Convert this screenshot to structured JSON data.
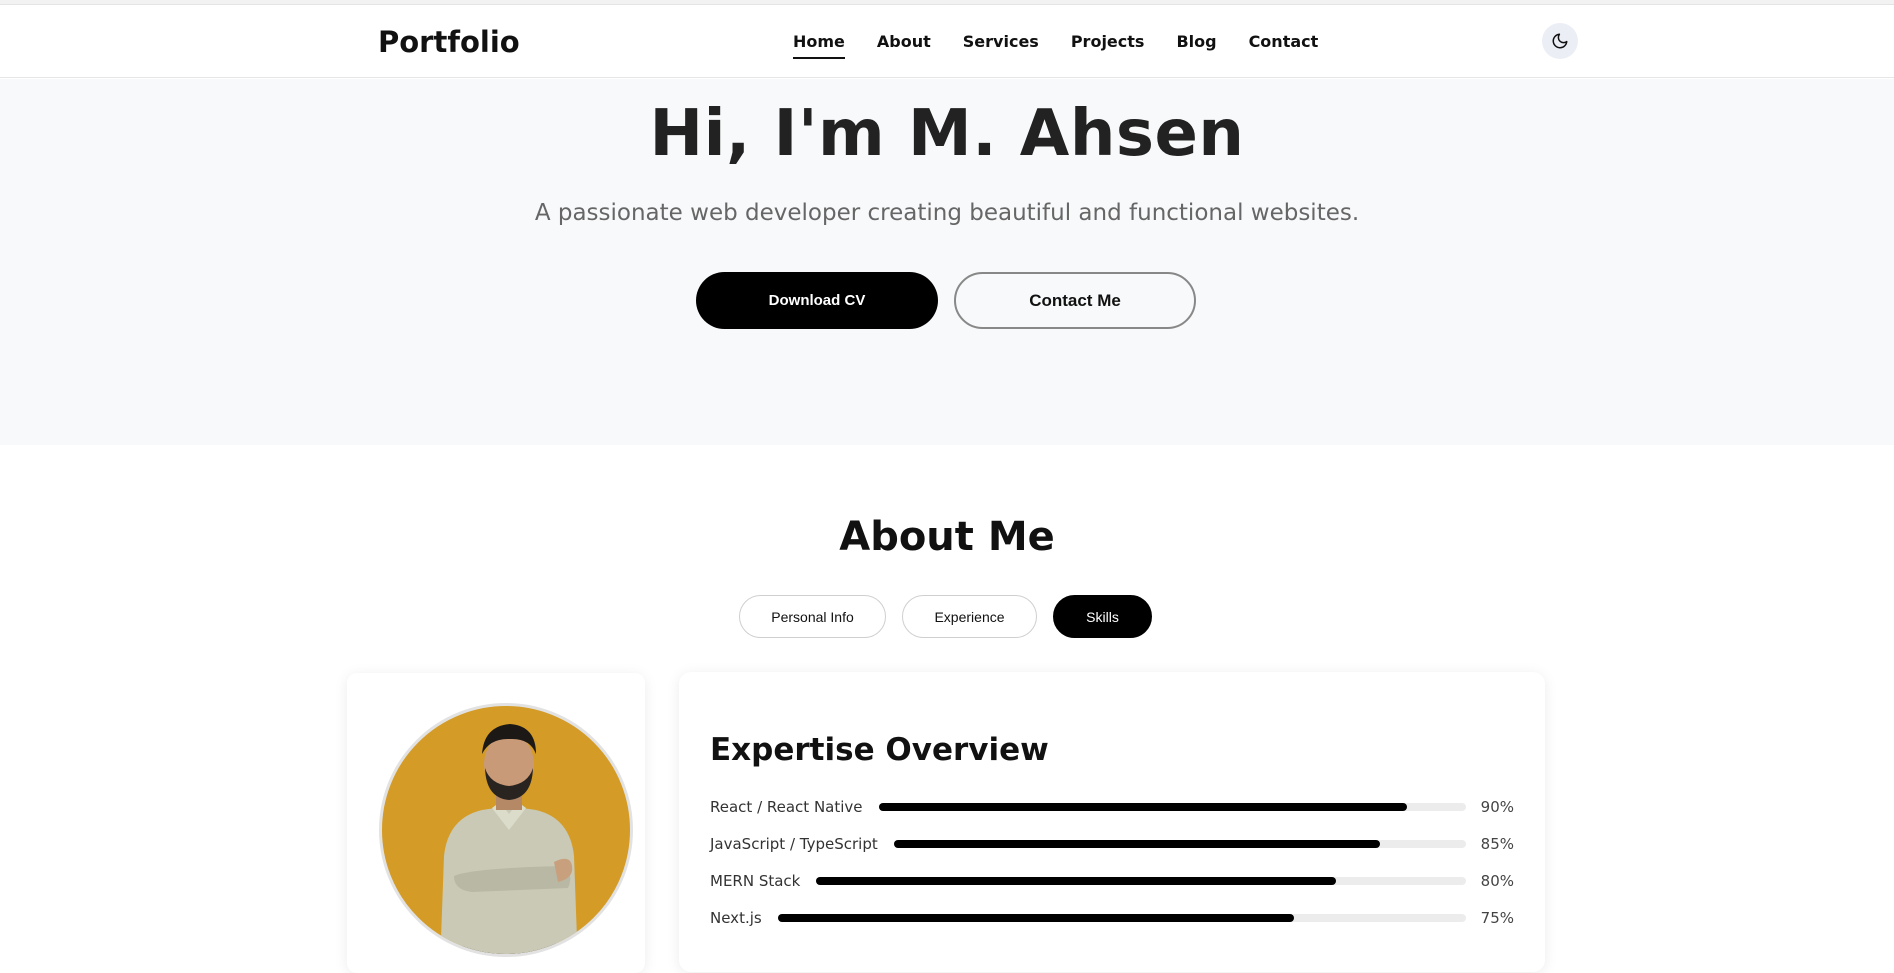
{
  "header": {
    "logo": "Portfolio",
    "nav": [
      {
        "label": "Home",
        "active": true
      },
      {
        "label": "About",
        "active": false
      },
      {
        "label": "Services",
        "active": false
      },
      {
        "label": "Projects",
        "active": false
      },
      {
        "label": "Blog",
        "active": false
      },
      {
        "label": "Contact",
        "active": false
      }
    ],
    "theme_toggle_icon": "moon-icon"
  },
  "hero": {
    "title": "Hi, I'm M. Ahsen",
    "subtitle": "A passionate web developer creating beautiful and functional websites.",
    "primary_button": "Download CV",
    "secondary_button": "Contact Me"
  },
  "about": {
    "title": "About Me",
    "tabs": [
      {
        "label": "Personal Info",
        "active": false
      },
      {
        "label": "Experience",
        "active": false
      },
      {
        "label": "Skills",
        "active": true
      }
    ],
    "avatar_color": "#d49b26",
    "skills": {
      "heading": "Expertise Overview",
      "items": [
        {
          "name": "React / React Native",
          "percent": 90,
          "label": "90%"
        },
        {
          "name": "JavaScript / TypeScript",
          "percent": 85,
          "label": "85%"
        },
        {
          "name": "MERN Stack",
          "percent": 80,
          "label": "80%"
        },
        {
          "name": "Next.js",
          "percent": 75,
          "label": "75%"
        }
      ]
    }
  },
  "colors": {
    "accent": "#000000",
    "hero_background": "#f8f9fa",
    "avatar_background": "#d49b26"
  }
}
